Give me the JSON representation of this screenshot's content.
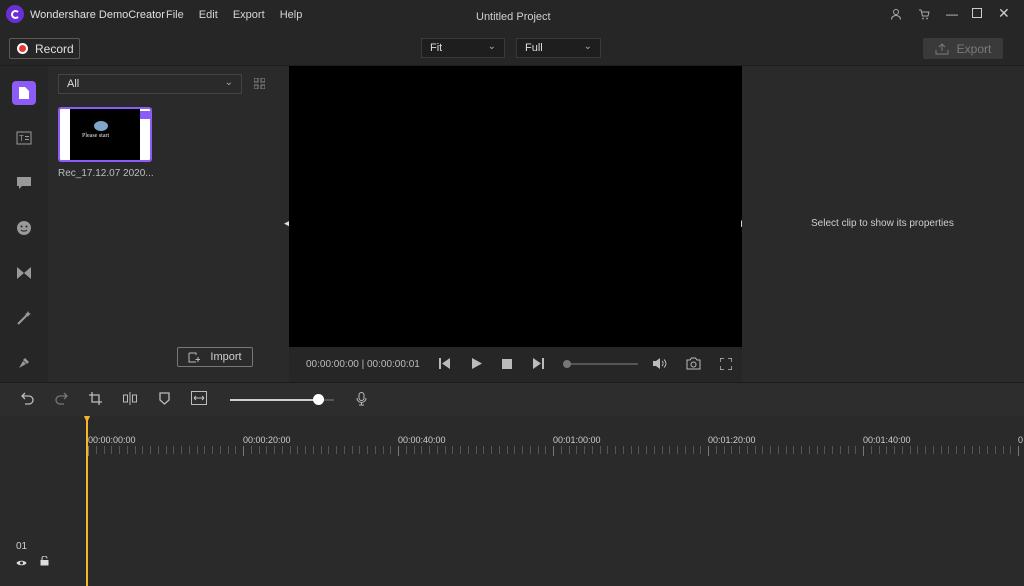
{
  "app": {
    "name": "Wondershare DemoCreator",
    "project_title": "Untitled Project"
  },
  "menu": [
    "File",
    "Edit",
    "Export",
    "Help"
  ],
  "toolbar": {
    "record_label": "Record",
    "fit_value": "Fit",
    "quality_value": "Full",
    "export_label": "Export"
  },
  "media": {
    "filter_value": "All",
    "clip_name": "Rec_17.12.07 2020...",
    "thumb_text": "Please start",
    "import_label": "Import"
  },
  "player": {
    "current_time": "00:00:00:00",
    "duration": "00:00:00:01",
    "separator": "|",
    "volume_level": 0
  },
  "props": {
    "empty_message": "Select clip to show its properties"
  },
  "timeline": {
    "zoom_level": 0.85,
    "ruler_labels": [
      "00:00:00:00",
      "00:00:20:00",
      "00:00:40:00",
      "00:01:00:00",
      "00:01:20:00",
      "00:01:40:00",
      "0"
    ],
    "track_number": "01"
  },
  "colors": {
    "accent": "#8b5cf6",
    "record": "#e53935",
    "playhead": "#f5b52e"
  }
}
